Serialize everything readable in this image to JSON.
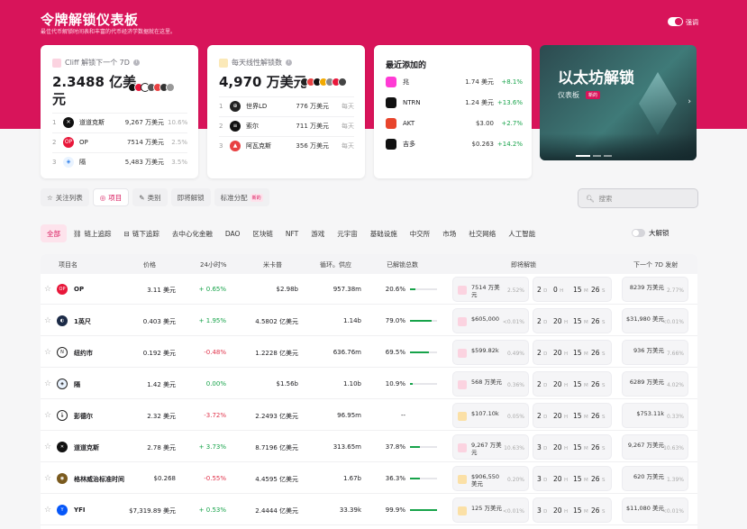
{
  "header": {
    "title": "令牌解锁仪表板",
    "subtitle": "最佳代币解锁时间表和丰富的代币经济学数据就在这里。",
    "toggle_label": "强调"
  },
  "cliff_card": {
    "title": "Cliff 解锁下一个 7D",
    "amount_line1": "2.3488 亿美",
    "amount_line2": "元",
    "items": [
      {
        "rank": "1",
        "name": "道道克斯",
        "value": "9,267 万美元",
        "pct": "10.6%",
        "color": "#111111",
        "glyph": "✕"
      },
      {
        "rank": "2",
        "name": "OP",
        "value": "7514 万美元",
        "pct": "2.5%",
        "color": "#e8173a",
        "glyph": "OP"
      },
      {
        "rank": "3",
        "name": "隔",
        "value": "5,483 万美元",
        "pct": "3.5%",
        "color": "#e9f3ff",
        "glyph": "◈"
      }
    ]
  },
  "linear_card": {
    "title": "每天线性解锁数",
    "amount": "4,970 万美元",
    "items": [
      {
        "rank": "1",
        "name": "世界LD",
        "value": "776 万美元",
        "dur": "每天",
        "color": "#222222",
        "glyph": "⊕"
      },
      {
        "rank": "2",
        "name": "索尔",
        "value": "711 万美元",
        "dur": "每天",
        "color": "#111111",
        "glyph": "≡"
      },
      {
        "rank": "3",
        "name": "阿瓦克斯",
        "value": "356 万美元",
        "dur": "每天",
        "color": "#e84142",
        "glyph": "▲"
      }
    ]
  },
  "recent_card": {
    "title": "最近添加的",
    "items": [
      {
        "name": "兆",
        "price": "1.74 美元",
        "change": "+8.1%",
        "color": "#ff3bd4"
      },
      {
        "name": "NTRN",
        "price": "1.24 美元",
        "change": "+13.6%",
        "color": "#111111"
      },
      {
        "name": "AKT",
        "price": "$3.00",
        "change": "+2.7%",
        "color": "#e8452c"
      },
      {
        "name": "吉多",
        "price": "$0.263",
        "change": "+14.2%",
        "color": "#111111"
      }
    ]
  },
  "banner": {
    "title": "以太坊解锁",
    "sub": "仪表板",
    "tag": "新的"
  },
  "tabs": [
    {
      "label": "关注列表",
      "icon": "☆",
      "active": false
    },
    {
      "label": "项目",
      "icon": "◎",
      "active": true
    },
    {
      "label": "类别",
      "icon": "✎",
      "active": false
    },
    {
      "label": "即将解锁",
      "icon": "",
      "active": false
    },
    {
      "label": "标准分配",
      "icon": "",
      "active": false,
      "badge": "新的"
    }
  ],
  "search": {
    "placeholder": "搜索"
  },
  "categories": [
    {
      "label": "全部",
      "active": true,
      "icon": ""
    },
    {
      "label": "链上追踪",
      "active": false,
      "icon": "⛓"
    },
    {
      "label": "链下追踪",
      "active": false,
      "icon": "⊟"
    },
    {
      "label": "去中心化金融",
      "active": false,
      "icon": ""
    },
    {
      "label": "DAO",
      "active": false,
      "icon": ""
    },
    {
      "label": "区块链",
      "active": false,
      "icon": ""
    },
    {
      "label": "NFT",
      "active": false,
      "icon": ""
    },
    {
      "label": "游戏",
      "active": false,
      "icon": ""
    },
    {
      "label": "元宇宙",
      "active": false,
      "icon": ""
    },
    {
      "label": "基础设施",
      "active": false,
      "icon": ""
    },
    {
      "label": "中交所",
      "active": false,
      "icon": ""
    },
    {
      "label": "市场",
      "active": false,
      "icon": ""
    },
    {
      "label": "社交网络",
      "active": false,
      "icon": ""
    },
    {
      "label": "人工智能",
      "active": false,
      "icon": ""
    }
  ],
  "big_unlock_label": "大解锁",
  "table": {
    "headers": [
      "项目名",
      "价格",
      "24小时%",
      "米卡普",
      "循环。供应",
      "已解锁总数",
      "即将解锁",
      "下一个 7D 发射"
    ],
    "rows": [
      {
        "name": "OP",
        "price": "3.11 美元",
        "change": "+ 0.65%",
        "dir": "up",
        "mcap": "$2.98b",
        "supply": "957.38m",
        "unlocked": "20.6%",
        "fill": 0.206,
        "ul_amt": "7514 万美元",
        "ul_pct": "2.52%",
        "ul_icon": "pink",
        "cd": [
          "2",
          "0",
          "15",
          "26"
        ],
        "nx_amt": "8239 万美元",
        "nx_pct": "2.77%",
        "color": "#e8173a",
        "glyph": "OP"
      },
      {
        "name": "1英尺",
        "price": "0.403 美元",
        "change": "+ 1.95%",
        "dir": "up",
        "mcap": "4.5802 亿美元",
        "supply": "1.14b",
        "unlocked": "79.0%",
        "fill": 0.79,
        "ul_amt": "$605,000",
        "ul_pct": "<0.01%",
        "ul_icon": "pink",
        "cd": [
          "2",
          "20",
          "15",
          "26"
        ],
        "nx_amt": "$31,980 美元",
        "nx_pct": "<0.01%",
        "color": "#1c2b47",
        "glyph": "◐"
      },
      {
        "name": "纽约市",
        "price": "0.192 美元",
        "change": "-0.48%",
        "dir": "down",
        "mcap": "1.2228 亿美元",
        "supply": "636.76m",
        "unlocked": "69.5%",
        "fill": 0.695,
        "ul_amt": "$599.82k",
        "ul_pct": "0.49%",
        "ul_icon": "pink",
        "cd": [
          "2",
          "20",
          "15",
          "26"
        ],
        "nx_amt": "936 万美元",
        "nx_pct": "7.66%",
        "color": "#ffffff",
        "glyph": "N"
      },
      {
        "name": "隔",
        "price": "1.42 美元",
        "change": "0.00%",
        "dir": "flat",
        "mcap": "$1.56b",
        "supply": "1.10b",
        "unlocked": "10.9%",
        "fill": 0.109,
        "ul_amt": "568 万美元",
        "ul_pct": "0.36%",
        "ul_icon": "pink",
        "cd": [
          "2",
          "20",
          "15",
          "26"
        ],
        "nx_amt": "6289 万美元",
        "nx_pct": "4.02%",
        "color": "#e9f3ff",
        "glyph": "◈"
      },
      {
        "name": "彭德尔",
        "price": "2.32 美元",
        "change": "-3.72%",
        "dir": "down",
        "mcap": "2.2493 亿美元",
        "supply": "96.95m",
        "unlocked": "--",
        "fill": 0,
        "ul_amt": "$107.10k",
        "ul_pct": "0.05%",
        "ul_icon": "yellow",
        "cd": [
          "2",
          "20",
          "15",
          "26"
        ],
        "nx_amt": "$753.11k",
        "nx_pct": "0.33%",
        "color": "#ffffff",
        "glyph": "🌡"
      },
      {
        "name": "道道克斯",
        "price": "2.78 美元",
        "change": "+ 3.73%",
        "dir": "up",
        "mcap": "8.7196 亿美元",
        "supply": "313.65m",
        "unlocked": "37.8%",
        "fill": 0.378,
        "ul_amt": "9,267 万美元",
        "ul_pct": "10.63%",
        "ul_icon": "pink",
        "cd": [
          "3",
          "20",
          "15",
          "26"
        ],
        "nx_amt": "9,267 万美元",
        "nx_pct": "10.63%",
        "color": "#111111",
        "glyph": "✕"
      },
      {
        "name": "格林威治标准时间",
        "price": "$0.268",
        "change": "-0.55%",
        "dir": "down",
        "mcap": "4.4595 亿美元",
        "supply": "1.67b",
        "unlocked": "36.3%",
        "fill": 0.363,
        "ul_amt": "$906,550 美元",
        "ul_pct": "0.20%",
        "ul_icon": "yellow",
        "cd": [
          "3",
          "20",
          "15",
          "26"
        ],
        "nx_amt": "620 万美元",
        "nx_pct": "1.39%",
        "color": "#7a5a1e",
        "glyph": "◉"
      },
      {
        "name": "YFI",
        "price": "$7,319.89 美元",
        "change": "+ 0.53%",
        "dir": "up",
        "mcap": "2.4444 亿美元",
        "supply": "33.39k",
        "unlocked": "99.9%",
        "fill": 0.999,
        "ul_amt": "125 万美元",
        "ul_pct": "<0.01%",
        "ul_icon": "yellow",
        "cd": [
          "3",
          "20",
          "15",
          "26"
        ],
        "nx_amt": "$11,080 美元",
        "nx_pct": "<0.01%",
        "color": "#0657f9",
        "glyph": "Y"
      }
    ]
  },
  "cd_units": {
    "d": "D",
    "h": "H",
    "m": "M",
    "s": "S"
  }
}
